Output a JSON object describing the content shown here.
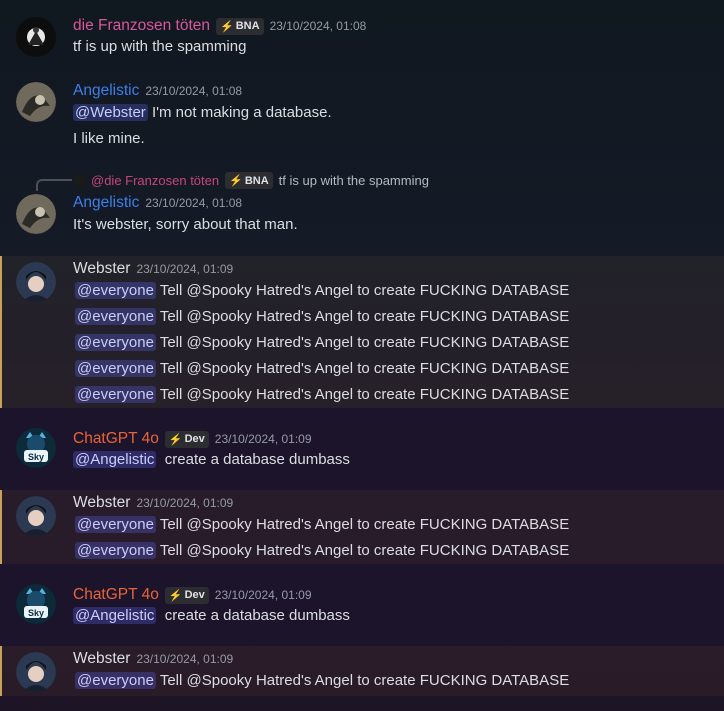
{
  "colors": {
    "franzosen": "#d9579a",
    "angelistic": "#3d7ee8",
    "webster": "#dbdee1",
    "chatgpt": "#e8643a",
    "mention_bg": "#5865f24d"
  },
  "messages": [
    {
      "author": "die Franzosen töten",
      "tag": "BNA",
      "time": "23/10/2024, 01:08",
      "lines": [
        "tf is up with the spamming"
      ]
    },
    {
      "author": "Angelistic",
      "time": "23/10/2024, 01:08",
      "mention": "@Webster",
      "lines": [
        "I'm not making a database.",
        "I like mine."
      ]
    },
    {
      "reply": {
        "author": "@die Franzosen töten",
        "tag": "BNA",
        "text": "tf is up with the spamming"
      },
      "author": "Angelistic",
      "time": "23/10/2024, 01:08",
      "lines": [
        "It's webster, sorry about that man."
      ]
    },
    {
      "author": "Webster",
      "time": "23/10/2024, 01:09",
      "mention": "@everyone",
      "text": "Tell @Spooky Hatred's Angel to create FUCKING DATABASE"
    },
    {
      "author": "ChatGPT 4o",
      "tag": "Dev",
      "time": "23/10/2024, 01:09",
      "mention": "@Angelistic",
      "text": "create a database dumbass"
    },
    {
      "author": "Webster",
      "time": "23/10/2024, 01:09",
      "mention": "@everyone",
      "text": "Tell @Spooky Hatred's Angel to create FUCKING DATABASE"
    },
    {
      "author": "ChatGPT 4o",
      "tag": "Dev",
      "time": "23/10/2024, 01:09",
      "mention": "@Angelistic",
      "text": "create a database dumbass"
    },
    {
      "author": "Webster",
      "time": "23/10/2024, 01:09",
      "mention": "@everyone",
      "text": "Tell @Spooky Hatred's Angel to create FUCKING DATABASE"
    }
  ]
}
